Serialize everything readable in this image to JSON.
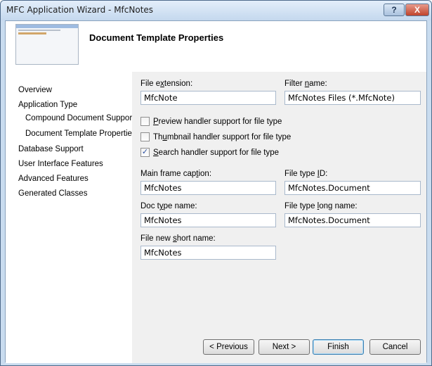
{
  "window": {
    "title": "MFC Application Wizard - MfcNotes",
    "help_label": "?",
    "close_label": "X"
  },
  "header": {
    "page_title": "Document Template Properties"
  },
  "sidebar": {
    "items": [
      {
        "label": "Overview"
      },
      {
        "label": "Application Type"
      },
      {
        "label": "Compound Document Support"
      },
      {
        "label": "Document Template Properties"
      },
      {
        "label": "Database Support"
      },
      {
        "label": "User Interface Features"
      },
      {
        "label": "Advanced Features"
      },
      {
        "label": "Generated Classes"
      }
    ]
  },
  "form": {
    "file_extension": {
      "label_pre": "File e",
      "label_key": "x",
      "label_post": "tension:",
      "value": "MfcNote"
    },
    "filter_name": {
      "label_pre": "Filter ",
      "label_key": "n",
      "label_post": "ame:",
      "value": "MfcNotes Files (*.MfcNote)"
    },
    "preview": {
      "label_key": "P",
      "label_post": "review handler support for file type",
      "checked": false
    },
    "thumbnail": {
      "label_pre": "Th",
      "label_key": "u",
      "label_post": "mbnail handler support for file type",
      "checked": false
    },
    "search": {
      "label_key": "S",
      "label_post": "earch handler support for file type",
      "checked": true,
      "check_glyph": "✓"
    },
    "main_frame_caption": {
      "label_pre": "Main frame cap",
      "label_key": "t",
      "label_post": "ion:",
      "value": "MfcNotes"
    },
    "file_type_id": {
      "label_pre": "File type ",
      "label_key": "I",
      "label_post": "D:",
      "value": "MfcNotes.Document"
    },
    "doc_type_name": {
      "label_pre": "Doc t",
      "label_key": "y",
      "label_post": "pe name:",
      "value": "MfcNotes"
    },
    "file_type_long_name": {
      "label_pre": "File type ",
      "label_key": "l",
      "label_post": "ong name:",
      "value": "MfcNotes.Document"
    },
    "file_new_short_name": {
      "label_pre": "File new ",
      "label_key": "s",
      "label_post": "hort name:",
      "value": "MfcNotes"
    }
  },
  "buttons": {
    "previous": "< Previous",
    "next": "Next >",
    "finish": "Finish",
    "cancel": "Cancel"
  },
  "colors": {
    "title_bg": "#c4d8ee",
    "panel_bg": "#f0f0f0",
    "checkmark": "#2a4fa0"
  }
}
